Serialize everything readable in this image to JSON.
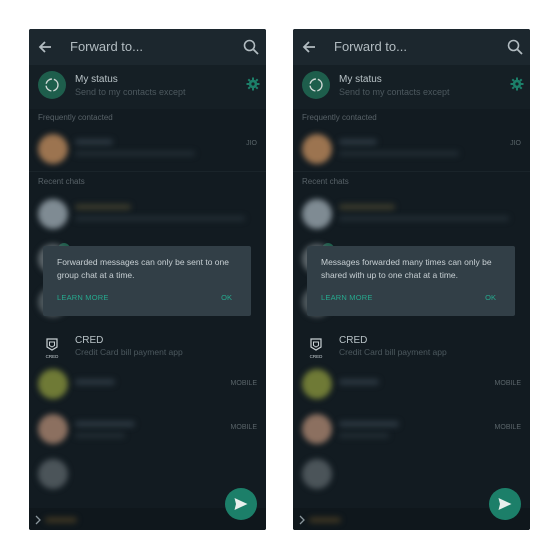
{
  "left": {
    "header": {
      "title": "Forward to..."
    },
    "status": {
      "title": "My status",
      "subtitle": "Send to my contacts except"
    },
    "sections": {
      "frequent": "Frequently contacted",
      "recent": "Recent chats"
    },
    "frequent_tag": "JIO",
    "dialog": {
      "message": "Forwarded messages can only be sent to one group chat at a time.",
      "learn_more": "LEARN MORE",
      "ok": "OK"
    },
    "cred": {
      "name": "CRED",
      "subtitle": "Credit Card bill payment app"
    },
    "tags": [
      "MOBILE",
      "MOBILE"
    ]
  },
  "right": {
    "header": {
      "title": "Forward to..."
    },
    "status": {
      "title": "My status",
      "subtitle": "Send to my contacts except"
    },
    "sections": {
      "frequent": "Frequently contacted",
      "recent": "Recent chats"
    },
    "frequent_tag": "JIO",
    "dialog": {
      "message": "Messages forwarded many times can only be shared with up to one chat at a time.",
      "learn_more": "LEARN MORE",
      "ok": "OK"
    },
    "cred": {
      "name": "CRED",
      "subtitle": "Credit Card bill payment app"
    },
    "tags": [
      "MOBILE",
      "MOBILE"
    ]
  },
  "colors": {
    "accent": "#26a98e",
    "background": "#121b21",
    "dialog": "#323f47",
    "fab": "#1c7f69"
  },
  "icons": [
    "back-arrow-icon",
    "search-icon",
    "status-icon",
    "gear-icon",
    "check-icon",
    "cred-logo-icon",
    "send-icon",
    "chevron-right-icon"
  ]
}
